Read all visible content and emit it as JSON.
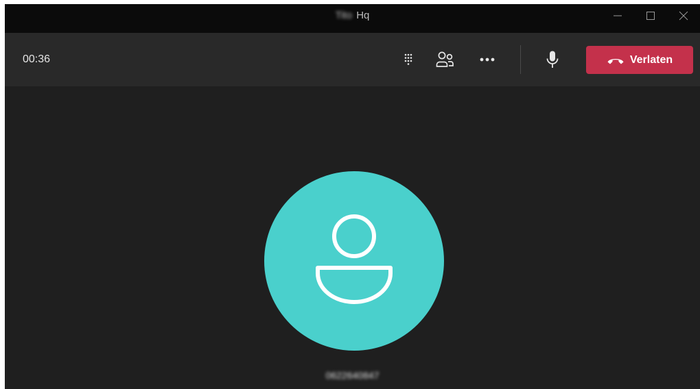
{
  "window": {
    "title_redacted": "Tito",
    "title": "Hq"
  },
  "toolbar": {
    "timer": "00:36",
    "dialpad_icon": "dialpad-icon",
    "participants_icon": "people-icon",
    "more_icon": "more-horizontal-icon",
    "mic_icon": "microphone-icon",
    "leave_label": "Verlaten",
    "leave_icon": "hang-up-icon"
  },
  "stage": {
    "avatar_icon": "person-icon",
    "caller_number": "0622640847"
  },
  "colors": {
    "background": "#1f1f1f",
    "titlebar": "#0b0b0b",
    "toolbar": "#292929",
    "avatar": "#4ad0cc",
    "leave": "#c4314b"
  }
}
